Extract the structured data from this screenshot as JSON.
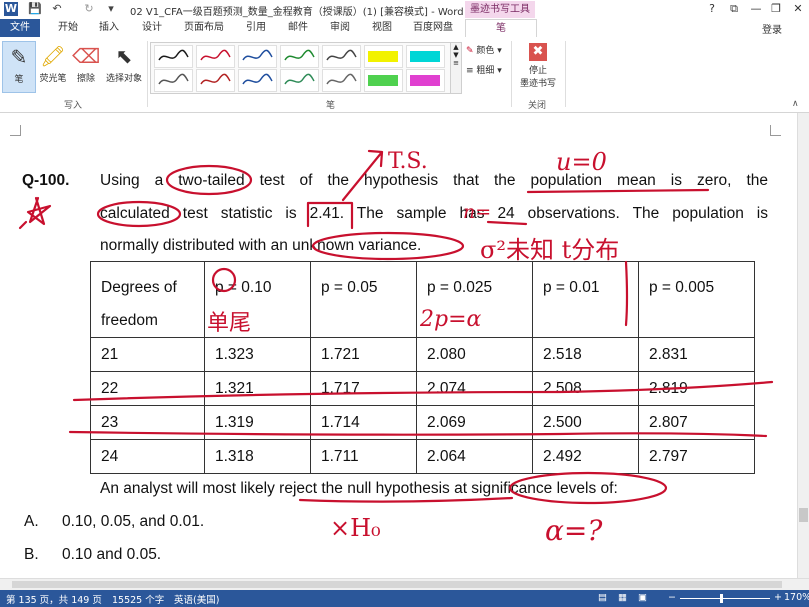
{
  "window": {
    "title": "02 V1_CFA一级百题预测_数量_金程教育（授课版）(1) [兼容模式] - Word",
    "contextual_tab_group": "墨迹书写工具",
    "login_label": "登录",
    "controls": {
      "help": "?",
      "restore": "⧉",
      "minimize": "—",
      "maximize": "❐",
      "close": "✕"
    }
  },
  "quick_access": {
    "app_icon": "W",
    "save_icon": "💾",
    "undo_icon": "↶",
    "redo_icon": "↻",
    "customize_icon": "▾"
  },
  "tabs": [
    {
      "label": "文件"
    },
    {
      "label": "开始"
    },
    {
      "label": "插入"
    },
    {
      "label": "设计"
    },
    {
      "label": "页面布局"
    },
    {
      "label": "引用"
    },
    {
      "label": "邮件"
    },
    {
      "label": "审阅"
    },
    {
      "label": "视图"
    },
    {
      "label": "百度网盘"
    },
    {
      "label": "笔"
    }
  ],
  "ribbon": {
    "write_group": {
      "label": "写入",
      "buttons": [
        {
          "label": "笔",
          "icon": "✎"
        },
        {
          "label": "荧光笔",
          "icon": "🖍"
        },
        {
          "label": "擦除",
          "icon": "⌫"
        },
        {
          "label": "选择对象",
          "icon": "⬉"
        }
      ]
    },
    "pens_group": {
      "label": "笔",
      "pens": [
        {
          "color": "#1a1a1a"
        },
        {
          "color": "#c8102e"
        },
        {
          "color": "#1f4e9e"
        },
        {
          "color": "#1e8a2f"
        },
        {
          "color": "#444444"
        },
        {
          "color": "#f2f200"
        },
        {
          "color": "#00d6d6"
        },
        {
          "color": "#555555"
        },
        {
          "color": "#b22222"
        },
        {
          "color": "#1f4e9e"
        },
        {
          "color": "#2e8b57"
        },
        {
          "color": "#666666"
        },
        {
          "color": "#4fd14f"
        },
        {
          "color": "#e040d0"
        }
      ],
      "color_label": "颜色",
      "thickness_label": "粗细"
    },
    "close_group": {
      "label": "关闭",
      "stop_label_1": "停止",
      "stop_label_2": "墨迹书写"
    }
  },
  "document": {
    "question_number": "Q-100.",
    "line1": "Using a two-tailed test of the hypothesis that the population mean is zero, the",
    "line2": "calculated test statistic is 2.41. The sample has 24 observations. The population is",
    "line3": "normally distributed with an unknown variance.",
    "table": {
      "header_top": [
        "Degrees of",
        "p = 0.10",
        "p = 0.05",
        "p = 0.025",
        "p = 0.01",
        "p = 0.005"
      ],
      "header_bottom": "freedom",
      "rows": [
        [
          "21",
          "1.323",
          "1.721",
          "2.080",
          "2.518",
          "2.831"
        ],
        [
          "22",
          "1.321",
          "1.717",
          "2.074",
          "2.508",
          "2.819"
        ],
        [
          "23",
          "1.319",
          "1.714",
          "2.069",
          "2.500",
          "2.807"
        ],
        [
          "24",
          "1.318",
          "1.711",
          "2.064",
          "2.492",
          "2.797"
        ]
      ]
    },
    "follow_up": "An analyst will most likely reject the null hypothesis at significance levels of:",
    "options": [
      {
        "letter": "A.",
        "text": "0.10, 0.05, and 0.01."
      },
      {
        "letter": "B.",
        "text": "0.10 and 0.05."
      }
    ]
  },
  "handwriting": {
    "ts": "T.S.",
    "mu0": "u=0",
    "n": "n=",
    "sigma_unknown": "σ²未知 t分布",
    "single_tail": "单尾",
    "two_p_alpha": "2p=α",
    "not_h0": "×H₀",
    "alpha_q": "α=?"
  },
  "status": {
    "page": "第 135 页，共 149 页",
    "words": "15525 个字",
    "language": "英语(美国)",
    "zoom": "170%",
    "zoom_minus": "−",
    "zoom_plus": "+"
  }
}
